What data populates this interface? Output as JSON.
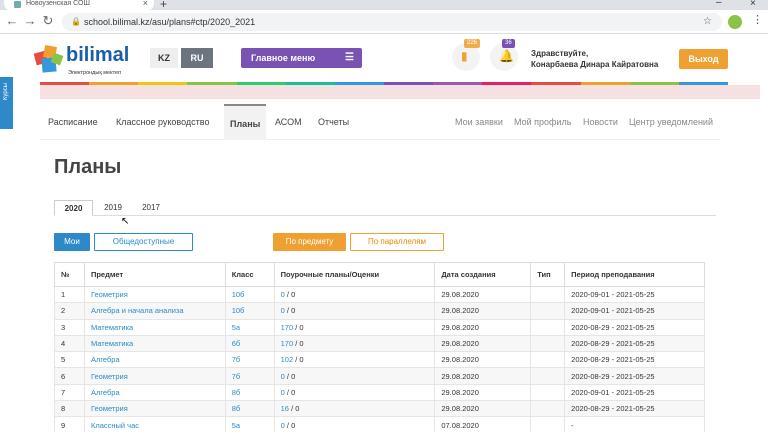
{
  "browser": {
    "tab_title": "Новоузенская СОШ",
    "url": "school.bilimal.kz/asu/plans#ctp/2020_2021"
  },
  "header": {
    "logo_text": "bilimal",
    "logo_sub": "Электрондық мектеп",
    "lang_kz": "KZ",
    "lang_ru": "RU",
    "main_menu": "Главное меню",
    "notif_1_count": "226",
    "notif_2_count": "36",
    "greeting_line1": "Здравствуйте,",
    "greeting_line2": "Конарбаева Динара Кайратовна",
    "logout": "Выход",
    "side_tab": "Курсы",
    "colorbar": [
      "#e74c3c",
      "#f0a030",
      "#f1c40f",
      "#8bc34a",
      "#2ecc71",
      "#1abc9c",
      "#3498db",
      "#7952b3",
      "#9b59b6",
      "#e91e63",
      "#e74c3c",
      "#f0a030",
      "#8bc34a",
      "#3498db"
    ]
  },
  "subnav": {
    "items": [
      "Расписание",
      "Классное руководство",
      "Планы",
      "АСОМ",
      "Отчеты"
    ],
    "right_items": [
      "Мои заявки",
      "Мой профиль",
      "Новости",
      "Центр уведомлений"
    ]
  },
  "page": {
    "title": "Планы",
    "years": [
      "2020",
      "2019",
      "2017"
    ],
    "btn_mine": "Мои",
    "btn_public": "Общедоступные",
    "btn_subject": "По предмету",
    "btn_parallel": "По параллелям"
  },
  "table": {
    "headers": [
      "№",
      "Предмет",
      "Класс",
      "Поурочные планы/Оценки",
      "Дата создания",
      "Тип",
      "Период преподавания"
    ],
    "rows": [
      {
        "n": "1",
        "subject": "Геометрия",
        "class": "10б",
        "plans": "0",
        "grades": "/ 0",
        "date": "29.08.2020",
        "type": "",
        "period": "2020-09-01 - 2021-05-25"
      },
      {
        "n": "2",
        "subject": "Алгебра и начала анализа",
        "class": "10б",
        "plans": "0",
        "grades": "/ 0",
        "date": "29.08.2020",
        "type": "",
        "period": "2020-09-01 - 2021-05-25"
      },
      {
        "n": "3",
        "subject": "Математика",
        "class": "5а",
        "plans": "170",
        "grades": "/ 0",
        "date": "29.08.2020",
        "type": "",
        "period": "2020-08-29 - 2021-05-25"
      },
      {
        "n": "4",
        "subject": "Математика",
        "class": "6б",
        "plans": "170",
        "grades": "/ 0",
        "date": "29.08.2020",
        "type": "",
        "period": "2020-08-29 - 2021-05-25"
      },
      {
        "n": "5",
        "subject": "Алгебра",
        "class": "7б",
        "plans": "102",
        "grades": "/ 0",
        "date": "29.08.2020",
        "type": "",
        "period": "2020-08-29 - 2021-05-25"
      },
      {
        "n": "6",
        "subject": "Геометрия",
        "class": "7б",
        "plans": "0",
        "grades": "/ 0",
        "date": "29.08.2020",
        "type": "",
        "period": "2020-08-29 - 2021-05-25"
      },
      {
        "n": "7",
        "subject": "Алгебра",
        "class": "8б",
        "plans": "0",
        "grades": "/ 0",
        "date": "29.08.2020",
        "type": "",
        "period": "2020-09-01 - 2021-05-25"
      },
      {
        "n": "8",
        "subject": "Геометрия",
        "class": "8б",
        "plans": "16",
        "grades": "/ 0",
        "date": "29.08.2020",
        "type": "",
        "period": "2020-08-29 - 2021-05-25"
      },
      {
        "n": "9",
        "subject": "Классный час",
        "class": "5а",
        "plans": "0",
        "grades": "/ 0",
        "date": "07.08.2020",
        "type": "",
        "period": "-"
      }
    ]
  }
}
